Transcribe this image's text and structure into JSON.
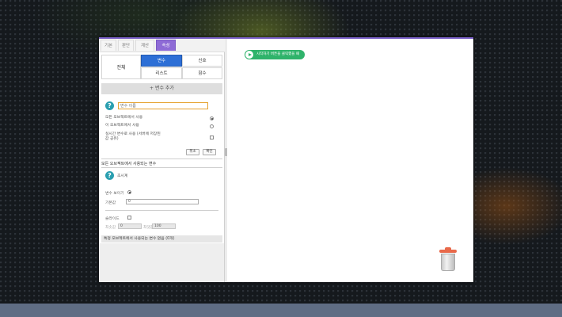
{
  "tabs": [
    {
      "label": "기본",
      "active": false
    },
    {
      "label": "판단",
      "active": false
    },
    {
      "label": "계산",
      "active": false
    },
    {
      "label": "속성",
      "active": true
    }
  ],
  "categories": {
    "all": "전체",
    "variable": "변수",
    "signal": "신호",
    "list": "리스트",
    "function": "함수"
  },
  "add_variable_header": "+ 변수 추가",
  "name_input": {
    "placeholder": "변수 이름",
    "value": ""
  },
  "scope_options": [
    {
      "label": "모든 오브젝트에서 사용",
      "selected": true
    },
    {
      "label": "이 오브젝트에서 사용",
      "selected": false
    }
  ],
  "cloud_option": {
    "label": "실시간 변수로 사용 (서버에 저장된 값 공유)",
    "checked": false
  },
  "buttons": {
    "cancel": "취소",
    "confirm": "확인"
  },
  "section1_label": "모든 오브젝트에서 사용되는 변수",
  "variable_item": {
    "name": "초시계"
  },
  "show_variable": {
    "label": "변수 보이기",
    "selected": true
  },
  "default_value": {
    "label": "기본값",
    "value": "0"
  },
  "slider": {
    "label": "슬라이드",
    "checked": false,
    "min_label": "최솟값",
    "min_value": "0",
    "max_label": "최댓값",
    "max_value": "100"
  },
  "section2_label": "특정 오브젝트에서 사용되는 변수 없음 (0개)",
  "canvas": {
    "start_block_label": "시작하기 버튼을 클릭했을 때",
    "trash_icon": "trash-can-icon"
  },
  "colors": {
    "active_tab": "#8e6bd6",
    "active_category": "#2d6fd6",
    "start_block": "#2fb36b",
    "info_icon": "#2a9fb0",
    "input_focus": "#e5a230",
    "trash_lid": "#e8694a"
  }
}
